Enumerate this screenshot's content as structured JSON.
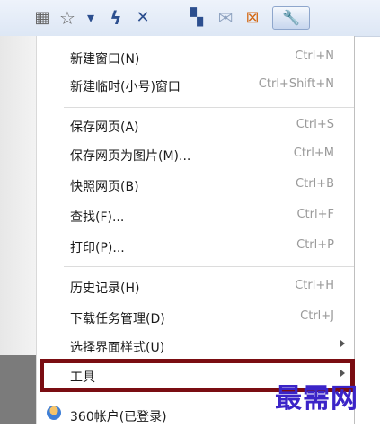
{
  "toolbar": {
    "icons": [
      "qr-code-icon",
      "star-icon",
      "dropdown-arrow-icon",
      "lightning-icon",
      "close-icon",
      "grid-icon",
      "mail-icon",
      "extension-icon",
      "wrench-icon"
    ],
    "glyphs": {
      "qr": "▦",
      "star": "☆",
      "dropdown": "▾",
      "lightning": "ϟ",
      "close": "✕",
      "grid": "▚",
      "mail": "✉",
      "ext": "⊠",
      "wrench": "🔧"
    }
  },
  "menu": {
    "items": [
      {
        "label": "新建窗口(N)",
        "shortcut": "Ctrl+N"
      },
      {
        "label": "新建临时(小号)窗口",
        "shortcut": "Ctrl+Shift+N"
      },
      {
        "label": "保存网页(A)",
        "shortcut": "Ctrl+S"
      },
      {
        "label": "保存网页为图片(M)...",
        "shortcut": "Ctrl+M"
      },
      {
        "label": "快照网页(B)",
        "shortcut": "Ctrl+B"
      },
      {
        "label": "查找(F)...",
        "shortcut": "Ctrl+F"
      },
      {
        "label": "打印(P)...",
        "shortcut": "Ctrl+P"
      },
      {
        "label": "历史记录(H)",
        "shortcut": "Ctrl+H"
      },
      {
        "label": "下载任务管理(D)",
        "shortcut": "Ctrl+J"
      },
      {
        "label": "选择界面样式(U)",
        "shortcut": ""
      },
      {
        "label": "工具",
        "shortcut": ""
      },
      {
        "label": "360帐户(已登录)",
        "shortcut": ""
      }
    ]
  },
  "watermark": "最需网",
  "colors": {
    "highlight_border": "#7a0d12",
    "watermark": "#3b24c8",
    "shortcut_text": "#9a9a9a"
  }
}
